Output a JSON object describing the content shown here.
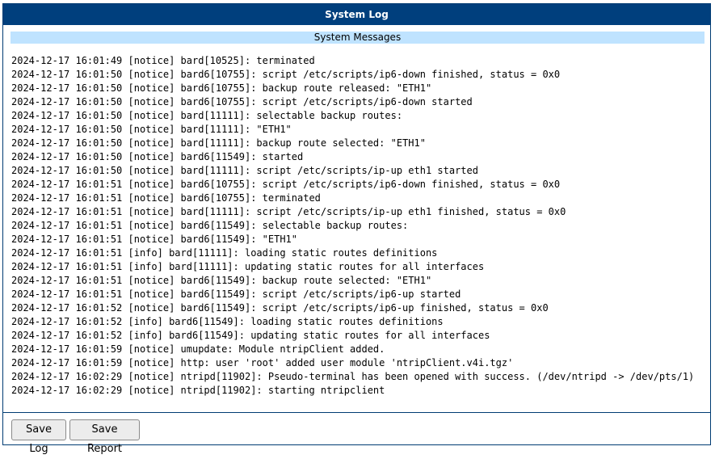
{
  "window": {
    "title": "System Log"
  },
  "section": {
    "title": "System Messages"
  },
  "log_lines": [
    "2024-12-17 16:01:49 [notice] bard[10525]: terminated",
    "2024-12-17 16:01:50 [notice] bard6[10755]: script /etc/scripts/ip6-down finished, status = 0x0",
    "2024-12-17 16:01:50 [notice] bard6[10755]: backup route released: \"ETH1\"",
    "2024-12-17 16:01:50 [notice] bard6[10755]: script /etc/scripts/ip6-down started",
    "2024-12-17 16:01:50 [notice] bard[11111]: selectable backup routes:",
    "2024-12-17 16:01:50 [notice] bard[11111]: \"ETH1\"",
    "2024-12-17 16:01:50 [notice] bard[11111]: backup route selected: \"ETH1\"",
    "2024-12-17 16:01:50 [notice] bard6[11549]: started",
    "2024-12-17 16:01:50 [notice] bard[11111]: script /etc/scripts/ip-up eth1 started",
    "2024-12-17 16:01:51 [notice] bard6[10755]: script /etc/scripts/ip6-down finished, status = 0x0",
    "2024-12-17 16:01:51 [notice] bard6[10755]: terminated",
    "2024-12-17 16:01:51 [notice] bard[11111]: script /etc/scripts/ip-up eth1 finished, status = 0x0",
    "2024-12-17 16:01:51 [notice] bard6[11549]: selectable backup routes:",
    "2024-12-17 16:01:51 [notice] bard6[11549]: \"ETH1\"",
    "2024-12-17 16:01:51 [info] bard[11111]: loading static routes definitions",
    "2024-12-17 16:01:51 [info] bard[11111]: updating static routes for all interfaces",
    "2024-12-17 16:01:51 [notice] bard6[11549]: backup route selected: \"ETH1\"",
    "2024-12-17 16:01:51 [notice] bard6[11549]: script /etc/scripts/ip6-up started",
    "2024-12-17 16:01:52 [notice] bard6[11549]: script /etc/scripts/ip6-up finished, status = 0x0",
    "2024-12-17 16:01:52 [info] bard6[11549]: loading static routes definitions",
    "2024-12-17 16:01:52 [info] bard6[11549]: updating static routes for all interfaces",
    "2024-12-17 16:01:59 [notice] umupdate: Module ntripClient added.",
    "2024-12-17 16:01:59 [notice] http: user 'root' added user module 'ntripClient.v4i.tgz'",
    "2024-12-17 16:02:29 [notice] ntripd[11902]: Pseudo-terminal has been opened with success. (/dev/ntripd -> /dev/pts/1)",
    "2024-12-17 16:02:29 [notice] ntripd[11902]: starting ntripclient"
  ],
  "buttons": {
    "save_log": "Save Log",
    "save_report": "Save Report"
  },
  "colors": {
    "titlebar": "#003f7d",
    "section_header": "#bfe3ff",
    "border": "#003b73"
  }
}
